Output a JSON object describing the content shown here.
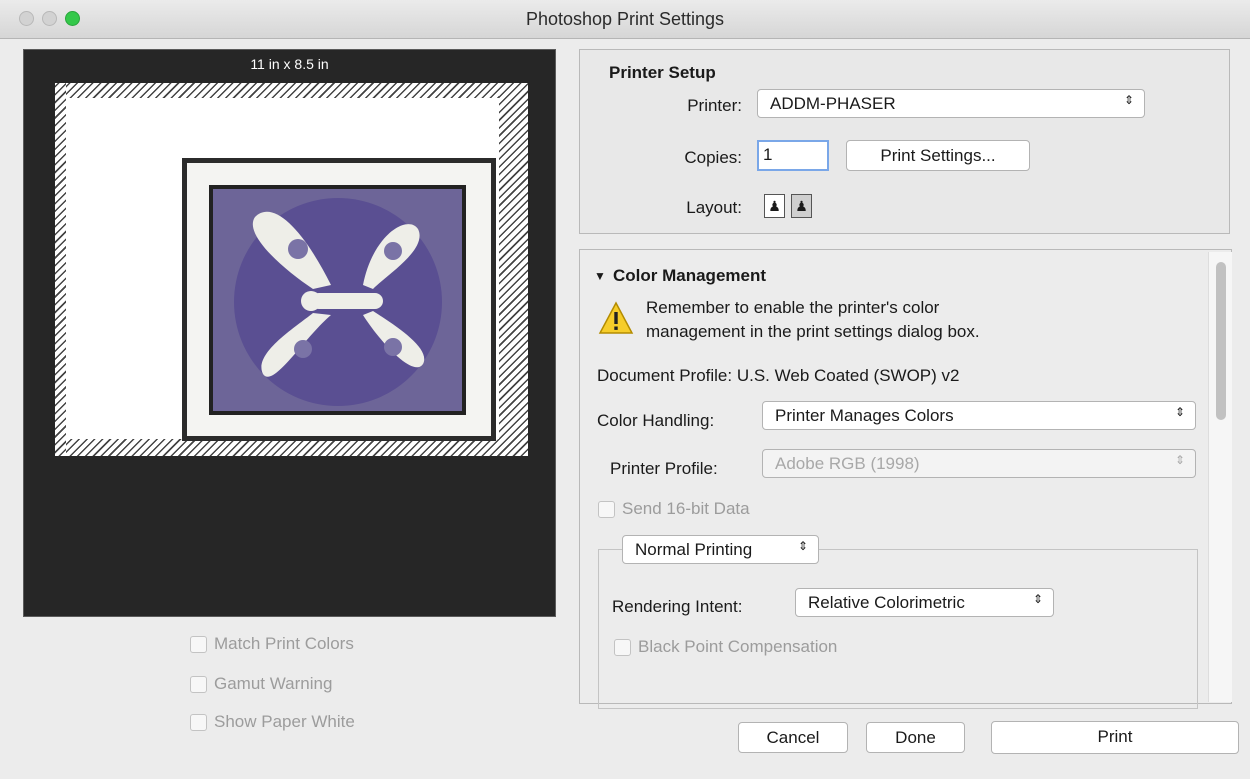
{
  "window": {
    "title": "Photoshop Print Settings"
  },
  "preview": {
    "paper_size": "11 in x 8.5 in",
    "options": [
      {
        "label": "Match Print Colors",
        "checked": false,
        "enabled": false
      },
      {
        "label": "Gamut Warning",
        "checked": false,
        "enabled": false
      },
      {
        "label": "Show Paper White",
        "checked": false,
        "enabled": false
      }
    ]
  },
  "printer_setup": {
    "title": "Printer Setup",
    "printer_label": "Printer:",
    "printer_value": "ADDM-PHASER",
    "copies_label": "Copies:",
    "copies_value": "1",
    "print_settings_button": "Print Settings...",
    "layout_label": "Layout:",
    "layout_options": [
      "portrait-icon",
      "landscape-icon"
    ],
    "layout_selected": "landscape-icon"
  },
  "color_management": {
    "title": "Color Management",
    "warning_line1": "Remember to enable the printer's color",
    "warning_line2": "management in the print settings dialog box.",
    "document_profile": "Document Profile: U.S. Web Coated (SWOP) v2",
    "color_handling_label": "Color Handling:",
    "color_handling_value": "Printer Manages Colors",
    "printer_profile_label": "Printer Profile:",
    "printer_profile_value": "Adobe RGB (1998)",
    "send_16bit_label": "Send 16-bit Data",
    "printing_mode": "Normal Printing",
    "rendering_intent_label": "Rendering Intent:",
    "rendering_intent_value": "Relative Colorimetric",
    "black_point_label": "Black Point Compensation"
  },
  "buttons": {
    "cancel": "Cancel",
    "done": "Done",
    "print": "Print"
  },
  "colors": {
    "preview_bg": "#262626",
    "accent_focus": "#7aa7e8",
    "traffic_green": "#34c84a"
  }
}
